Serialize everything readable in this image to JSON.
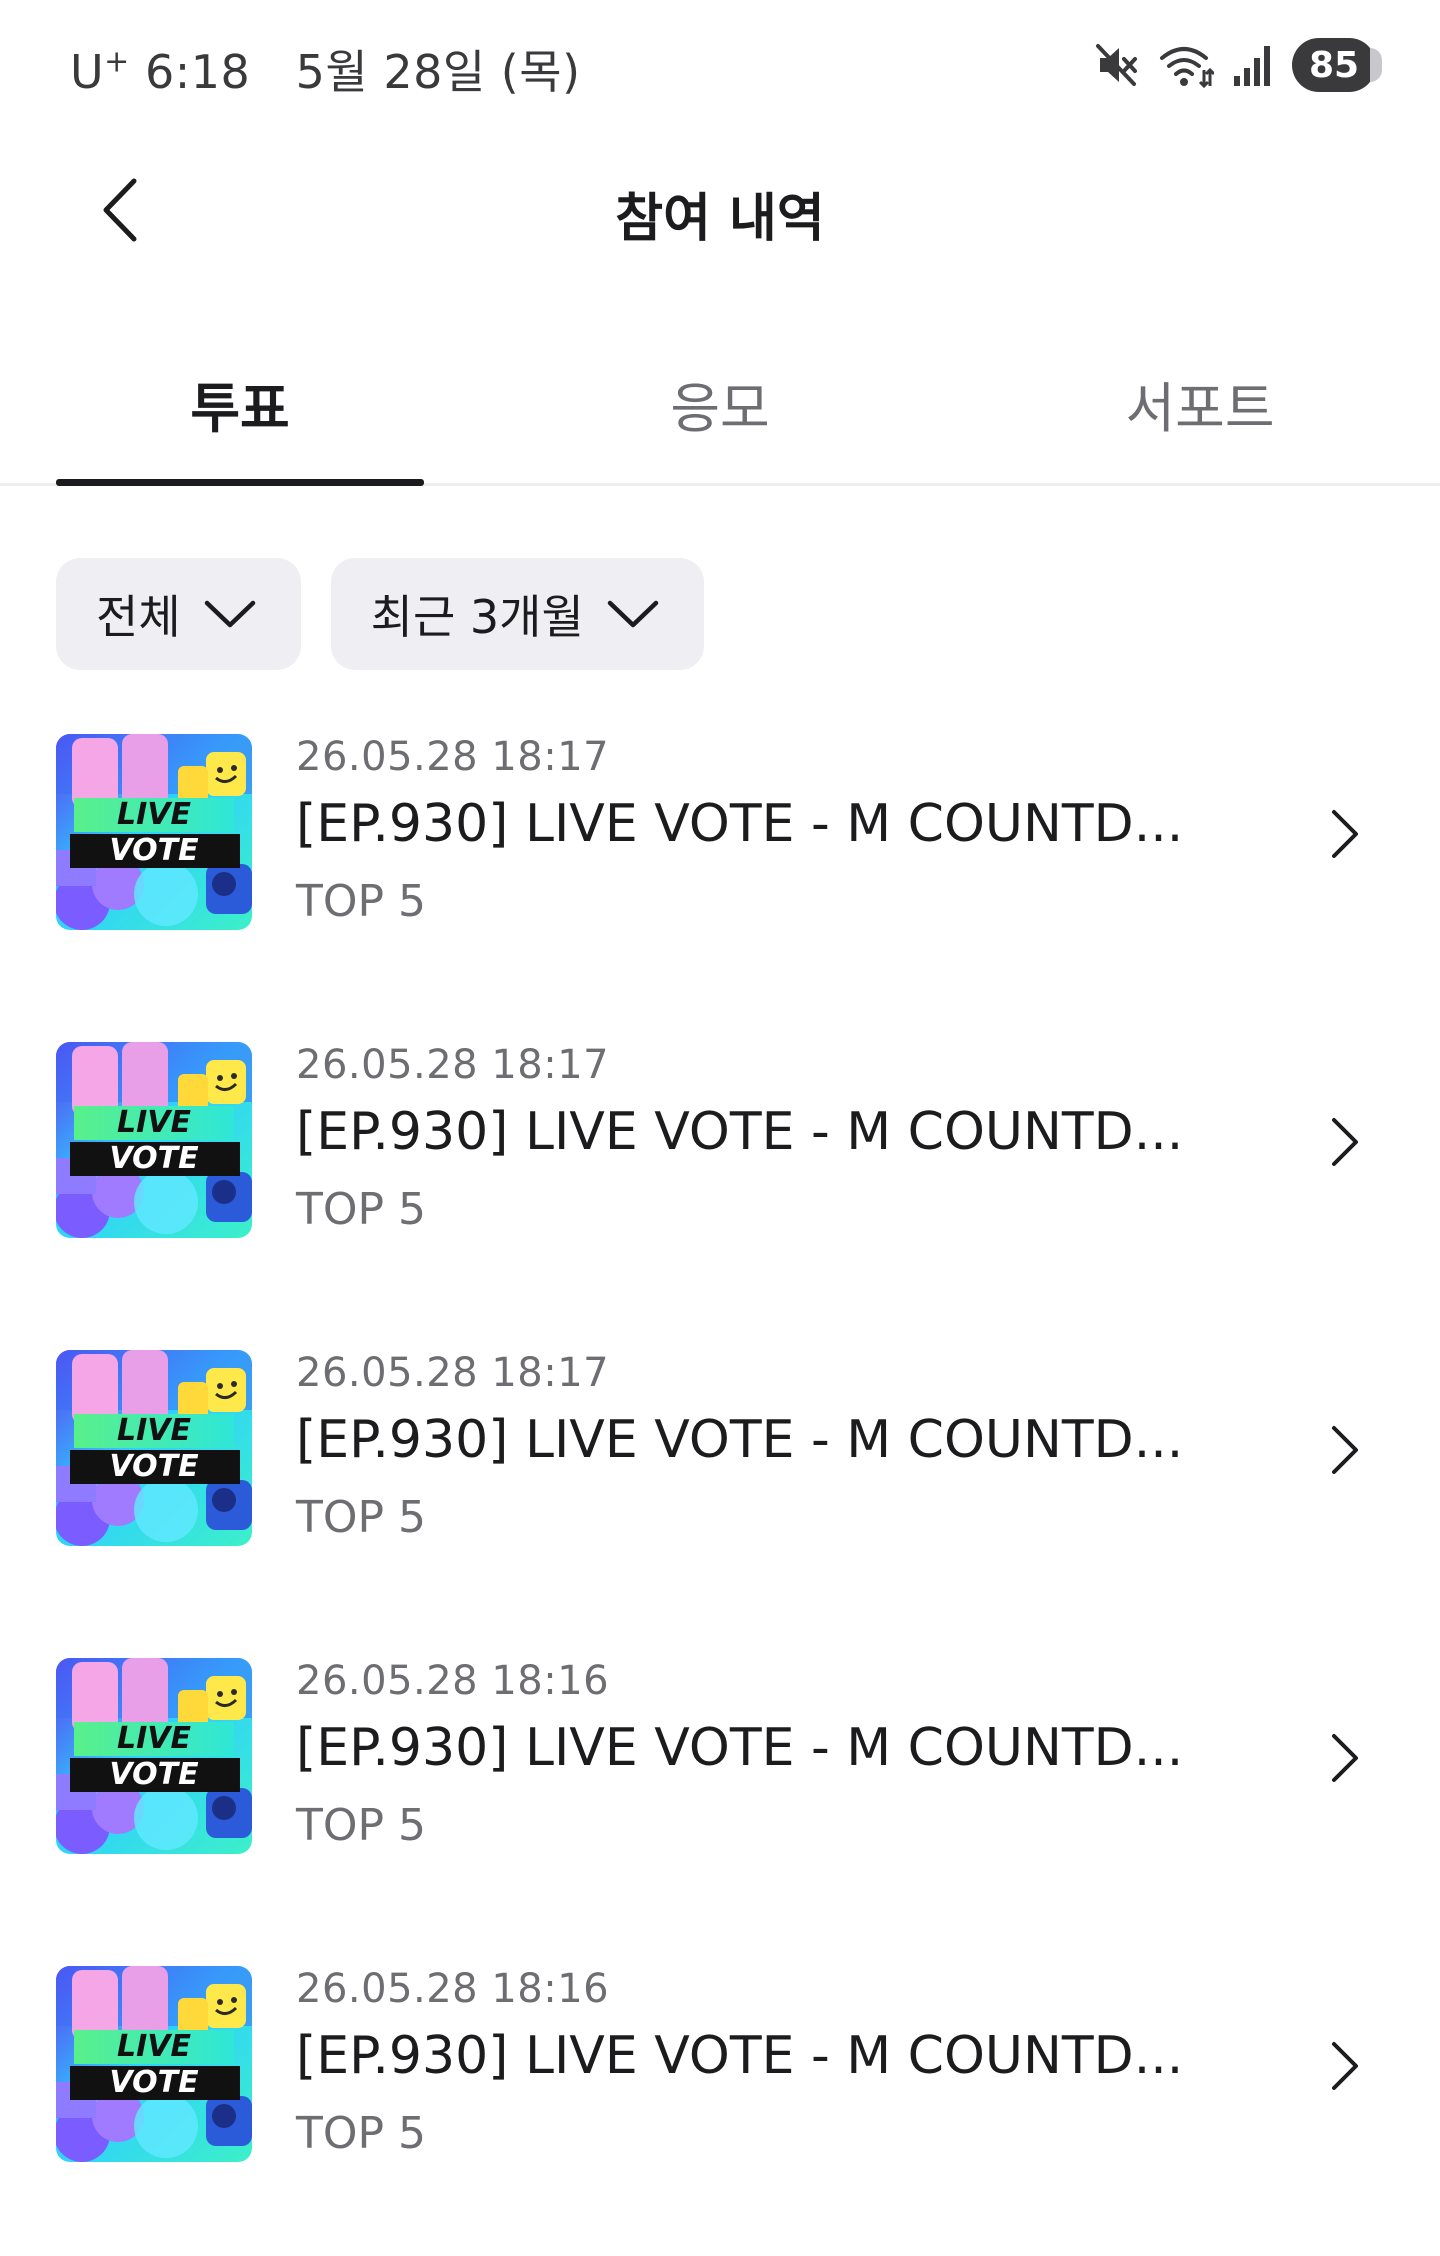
{
  "status_bar": {
    "carrier": "U",
    "carrier_sup": "+",
    "time": "6:18",
    "date": "5월 28일 (목)",
    "battery": "85",
    "icons": [
      "mute-icon",
      "wifi-icon",
      "signal-icon"
    ]
  },
  "header": {
    "title": "참여 내역",
    "back_icon": "chevron-left-icon"
  },
  "tabs": [
    {
      "label": "투표",
      "active": true
    },
    {
      "label": "응모",
      "active": false
    },
    {
      "label": "서포트",
      "active": false
    }
  ],
  "filters": {
    "type": {
      "label": "전체",
      "icon": "chevron-down-icon"
    },
    "period": {
      "label": "최근 3개월",
      "icon": "chevron-down-icon"
    }
  },
  "thumbnail": {
    "line1": "LIVE",
    "line2": "VOTE"
  },
  "items": [
    {
      "date": "26.05.28 18:17",
      "title": "[EP.930] LIVE VOTE - M COUNTD...",
      "subtitle": "TOP 5"
    },
    {
      "date": "26.05.28 18:17",
      "title": "[EP.930] LIVE VOTE - M COUNTD...",
      "subtitle": "TOP 5"
    },
    {
      "date": "26.05.28 18:17",
      "title": "[EP.930] LIVE VOTE - M COUNTD...",
      "subtitle": "TOP 5"
    },
    {
      "date": "26.05.28 18:16",
      "title": "[EP.930] LIVE VOTE - M COUNTD...",
      "subtitle": "TOP 5"
    },
    {
      "date": "26.05.28 18:16",
      "title": "[EP.930] LIVE VOTE - M COUNTD...",
      "subtitle": "TOP 5"
    }
  ]
}
